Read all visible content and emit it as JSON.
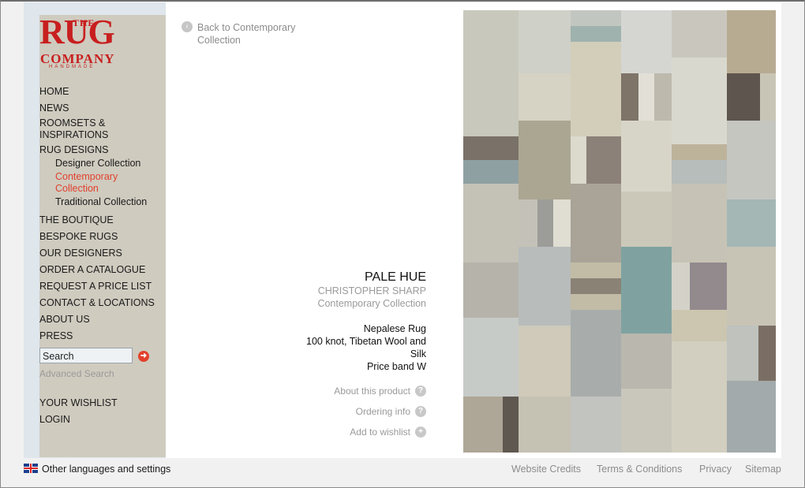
{
  "brand": {
    "logo_the": "THE",
    "logo_rug": "RUG",
    "logo_company": "COMPANY",
    "logo_handmade": "HANDMADE",
    "accent_color": "#e2412d"
  },
  "nav": {
    "items": [
      {
        "label": "HOME"
      },
      {
        "label": "NEWS"
      },
      {
        "label": "ROOMSETS &"
      },
      {
        "label": "INSPIRATIONS"
      },
      {
        "label": "RUG DESIGNS"
      },
      {
        "label": "THE BOUTIQUE"
      },
      {
        "label": "BESPOKE RUGS"
      },
      {
        "label": "OUR DESIGNERS"
      },
      {
        "label": "ORDER A CATALOGUE"
      },
      {
        "label": "REQUEST A PRICE LIST"
      },
      {
        "label": "CONTACT & LOCATIONS"
      },
      {
        "label": "ABOUT US"
      },
      {
        "label": "PRESS"
      },
      {
        "label": "YOUR WISHLIST"
      },
      {
        "label": "LOGIN"
      }
    ],
    "sub_items": [
      {
        "label": "Designer Collection"
      },
      {
        "label": "Contemporary"
      },
      {
        "label": "Collection"
      },
      {
        "label": "Traditional Collection"
      }
    ]
  },
  "search": {
    "value": "Search",
    "advanced_label": "Advanced Search",
    "go_icon": "arrow-right-icon"
  },
  "back": {
    "line1": "Back to Contemporary",
    "line2": "Collection",
    "icon": "arrow-left-icon"
  },
  "product": {
    "title": "PALE HUE",
    "designer": "CHRISTOPHER SHARP",
    "collection": "Contemporary Collection",
    "spec_type": "Nepalese Rug",
    "spec_material_1": "100 knot, Tibetan Wool and",
    "spec_material_2": "Silk",
    "spec_price": "Price band W"
  },
  "product_links": [
    {
      "label": "About this product",
      "icon": "question-icon"
    },
    {
      "label": "Ordering info",
      "icon": "question-icon"
    },
    {
      "label": "Add to wishlist",
      "icon": "plus-icon"
    }
  ],
  "footer": {
    "languages": "Other languages and settings",
    "credits": "Website Credits",
    "terms": "Terms & Conditions",
    "privacy": "Privacy",
    "sitemap": "Sitemap"
  }
}
